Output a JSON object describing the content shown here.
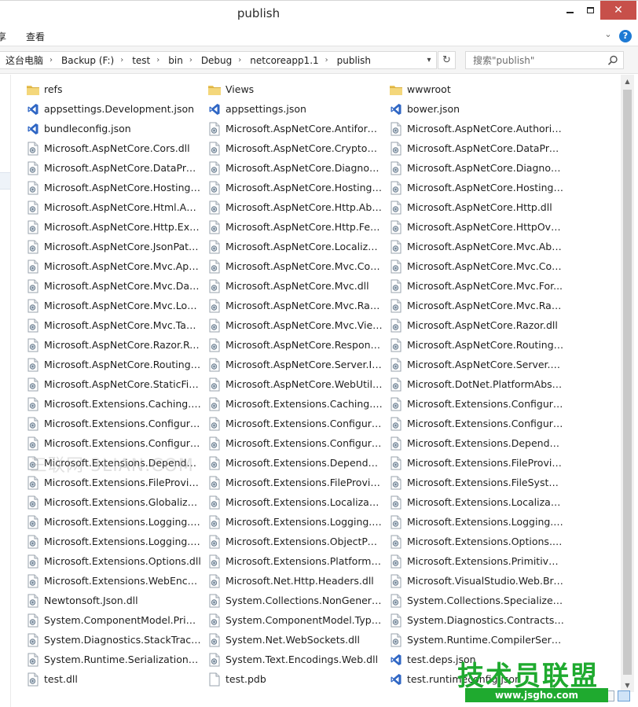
{
  "window": {
    "title": "publish"
  },
  "ribbon": {
    "tabs": [
      "享",
      "查看"
    ]
  },
  "address": {
    "breadcrumbs": [
      "这台电脑",
      "Backup (F:)",
      "test",
      "bin",
      "Debug",
      "netcoreapp1.1",
      "publish"
    ]
  },
  "search": {
    "placeholder": "搜索\"publish\""
  },
  "columns": [
    [
      {
        "name": "refs",
        "icon": "folder-icon"
      },
      {
        "name": "appsettings.Development.json",
        "icon": "vs-json-icon"
      },
      {
        "name": "bundleconfig.json",
        "icon": "vs-json-icon"
      },
      {
        "name": "Microsoft.AspNetCore.Cors.dll",
        "icon": "dll-icon"
      },
      {
        "name": "Microsoft.AspNetCore.DataProt...",
        "icon": "dll-icon"
      },
      {
        "name": "Microsoft.AspNetCore.Hosting.A...",
        "icon": "dll-icon"
      },
      {
        "name": "Microsoft.AspNetCore.Html.Abst...",
        "icon": "dll-icon"
      },
      {
        "name": "Microsoft.AspNetCore.Http.Exte...",
        "icon": "dll-icon"
      },
      {
        "name": "Microsoft.AspNetCore.JsonPatc...",
        "icon": "dll-icon"
      },
      {
        "name": "Microsoft.AspNetCore.Mvc.ApiE...",
        "icon": "dll-icon"
      },
      {
        "name": "Microsoft.AspNetCore.Mvc.Data...",
        "icon": "dll-icon"
      },
      {
        "name": "Microsoft.AspNetCore.Mvc.Loca...",
        "icon": "dll-icon"
      },
      {
        "name": "Microsoft.AspNetCore.Mvc.Tag...",
        "icon": "dll-icon"
      },
      {
        "name": "Microsoft.AspNetCore.Razor.Ru...",
        "icon": "dll-icon"
      },
      {
        "name": "Microsoft.AspNetCore.Routing.dll",
        "icon": "dll-icon"
      },
      {
        "name": "Microsoft.AspNetCore.StaticFiles...",
        "icon": "dll-icon"
      },
      {
        "name": "Microsoft.Extensions.Caching.Ab...",
        "icon": "dll-icon"
      },
      {
        "name": "Microsoft.Extensions.Configurati...",
        "icon": "dll-icon"
      },
      {
        "name": "Microsoft.Extensions.Configurati...",
        "icon": "dll-icon"
      },
      {
        "name": "Microsoft.Extensions.Dependenc...",
        "icon": "dll-icon"
      },
      {
        "name": "Microsoft.Extensions.FileProvide...",
        "icon": "dll-icon"
      },
      {
        "name": "Microsoft.Extensions.Globalizati...",
        "icon": "dll-icon"
      },
      {
        "name": "Microsoft.Extensions.Logging.A...",
        "icon": "dll-icon"
      },
      {
        "name": "Microsoft.Extensions.Logging.dll",
        "icon": "dll-icon"
      },
      {
        "name": "Microsoft.Extensions.Options.dll",
        "icon": "dll-icon"
      },
      {
        "name": "Microsoft.Extensions.WebEncod...",
        "icon": "dll-icon"
      },
      {
        "name": "Newtonsoft.Json.dll",
        "icon": "dll-icon"
      },
      {
        "name": "System.ComponentModel.Primiti...",
        "icon": "dll-icon"
      },
      {
        "name": "System.Diagnostics.StackTrace.dll",
        "icon": "dll-icon"
      },
      {
        "name": "System.Runtime.Serialization.Pri...",
        "icon": "dll-icon"
      },
      {
        "name": "test.dll",
        "icon": "dll-icon"
      }
    ],
    [
      {
        "name": "Views",
        "icon": "folder-icon"
      },
      {
        "name": "appsettings.json",
        "icon": "vs-json-icon"
      },
      {
        "name": "Microsoft.AspNetCore.Antiforge...",
        "icon": "dll-icon"
      },
      {
        "name": "Microsoft.AspNetCore.Cryptogr...",
        "icon": "dll-icon"
      },
      {
        "name": "Microsoft.AspNetCore.Diagnosti...",
        "icon": "dll-icon"
      },
      {
        "name": "Microsoft.AspNetCore.Hosting.dll",
        "icon": "dll-icon"
      },
      {
        "name": "Microsoft.AspNetCore.Http.Abst...",
        "icon": "dll-icon"
      },
      {
        "name": "Microsoft.AspNetCore.Http.Feat...",
        "icon": "dll-icon"
      },
      {
        "name": "Microsoft.AspNetCore.Localizati...",
        "icon": "dll-icon"
      },
      {
        "name": "Microsoft.AspNetCore.Mvc.Core...",
        "icon": "dll-icon"
      },
      {
        "name": "Microsoft.AspNetCore.Mvc.dll",
        "icon": "dll-icon"
      },
      {
        "name": "Microsoft.AspNetCore.Mvc.Razo...",
        "icon": "dll-icon"
      },
      {
        "name": "Microsoft.AspNetCore.Mvc.View...",
        "icon": "dll-icon"
      },
      {
        "name": "Microsoft.AspNetCore.Respons...",
        "icon": "dll-icon"
      },
      {
        "name": "Microsoft.AspNetCore.Server.IIS...",
        "icon": "dll-icon"
      },
      {
        "name": "Microsoft.AspNetCore.WebUtiliti...",
        "icon": "dll-icon"
      },
      {
        "name": "Microsoft.Extensions.Caching.M...",
        "icon": "dll-icon"
      },
      {
        "name": "Microsoft.Extensions.Configurati...",
        "icon": "dll-icon"
      },
      {
        "name": "Microsoft.Extensions.Configurati...",
        "icon": "dll-icon"
      },
      {
        "name": "Microsoft.Extensions.Dependenc...",
        "icon": "dll-icon"
      },
      {
        "name": "Microsoft.Extensions.FileProvide...",
        "icon": "dll-icon"
      },
      {
        "name": "Microsoft.Extensions.Localizatio...",
        "icon": "dll-icon"
      },
      {
        "name": "Microsoft.Extensions.Logging.C...",
        "icon": "dll-icon"
      },
      {
        "name": "Microsoft.Extensions.ObjectPool...",
        "icon": "dll-icon"
      },
      {
        "name": "Microsoft.Extensions.PlatformAb...",
        "icon": "dll-icon"
      },
      {
        "name": "Microsoft.Net.Http.Headers.dll",
        "icon": "dll-icon"
      },
      {
        "name": "System.Collections.NonGeneric.dll",
        "icon": "dll-icon"
      },
      {
        "name": "System.ComponentModel.TypeC...",
        "icon": "dll-icon"
      },
      {
        "name": "System.Net.WebSockets.dll",
        "icon": "dll-icon"
      },
      {
        "name": "System.Text.Encodings.Web.dll",
        "icon": "dll-icon"
      },
      {
        "name": "test.pdb",
        "icon": "file-icon"
      }
    ],
    [
      {
        "name": "wwwroot",
        "icon": "folder-icon"
      },
      {
        "name": "bower.json",
        "icon": "vs-json-icon"
      },
      {
        "name": "Microsoft.AspNetCore.Authoriza...",
        "icon": "dll-icon"
      },
      {
        "name": "Microsoft.AspNetCore.DataProt...",
        "icon": "dll-icon"
      },
      {
        "name": "Microsoft.AspNetCore.Diagnosti...",
        "icon": "dll-icon"
      },
      {
        "name": "Microsoft.AspNetCore.Hosting.S...",
        "icon": "dll-icon"
      },
      {
        "name": "Microsoft.AspNetCore.Http.dll",
        "icon": "dll-icon"
      },
      {
        "name": "Microsoft.AspNetCore.HttpOver...",
        "icon": "dll-icon"
      },
      {
        "name": "Microsoft.AspNetCore.Mvc.Abst...",
        "icon": "dll-icon"
      },
      {
        "name": "Microsoft.AspNetCore.Mvc.Cors...",
        "icon": "dll-icon"
      },
      {
        "name": "Microsoft.AspNetCore.Mvc.For...",
        "icon": "dll-icon"
      },
      {
        "name": "Microsoft.AspNetCore.Mvc.Razo...",
        "icon": "dll-icon"
      },
      {
        "name": "Microsoft.AspNetCore.Razor.dll",
        "icon": "dll-icon"
      },
      {
        "name": "Microsoft.AspNetCore.Routing.A...",
        "icon": "dll-icon"
      },
      {
        "name": "Microsoft.AspNetCore.Server.Ke...",
        "icon": "dll-icon"
      },
      {
        "name": "Microsoft.DotNet.PlatformAbstr...",
        "icon": "dll-icon"
      },
      {
        "name": "Microsoft.Extensions.Configurati...",
        "icon": "dll-icon"
      },
      {
        "name": "Microsoft.Extensions.Configurati...",
        "icon": "dll-icon"
      },
      {
        "name": "Microsoft.Extensions.Dependenc...",
        "icon": "dll-icon"
      },
      {
        "name": "Microsoft.Extensions.FileProvide...",
        "icon": "dll-icon"
      },
      {
        "name": "Microsoft.Extensions.FileSystem...",
        "icon": "dll-icon"
      },
      {
        "name": "Microsoft.Extensions.Localizatio...",
        "icon": "dll-icon"
      },
      {
        "name": "Microsoft.Extensions.Logging.D...",
        "icon": "dll-icon"
      },
      {
        "name": "Microsoft.Extensions.Options.Co...",
        "icon": "dll-icon"
      },
      {
        "name": "Microsoft.Extensions.Primitives.dll",
        "icon": "dll-icon"
      },
      {
        "name": "Microsoft.VisualStudio.Web.Bro...",
        "icon": "dll-icon"
      },
      {
        "name": "System.Collections.Specialized.dll",
        "icon": "dll-icon"
      },
      {
        "name": "System.Diagnostics.Contracts.dll",
        "icon": "dll-icon"
      },
      {
        "name": "System.Runtime.CompilerService...",
        "icon": "dll-icon"
      },
      {
        "name": "test.deps.json",
        "icon": "vs-json-icon"
      },
      {
        "name": "test.runtimeconfig.json",
        "icon": "vs-json-icon"
      }
    ]
  ],
  "watermarks": {
    "faint": "三联网 3LIAN.COM",
    "brand": "技术员联盟",
    "url": "www.jsgho.com"
  },
  "colors": {
    "close_button": "#c7504a",
    "folder": "#e8c35a",
    "vs_purple": "#2f66c4",
    "watermark_green": "#1faa2f"
  }
}
